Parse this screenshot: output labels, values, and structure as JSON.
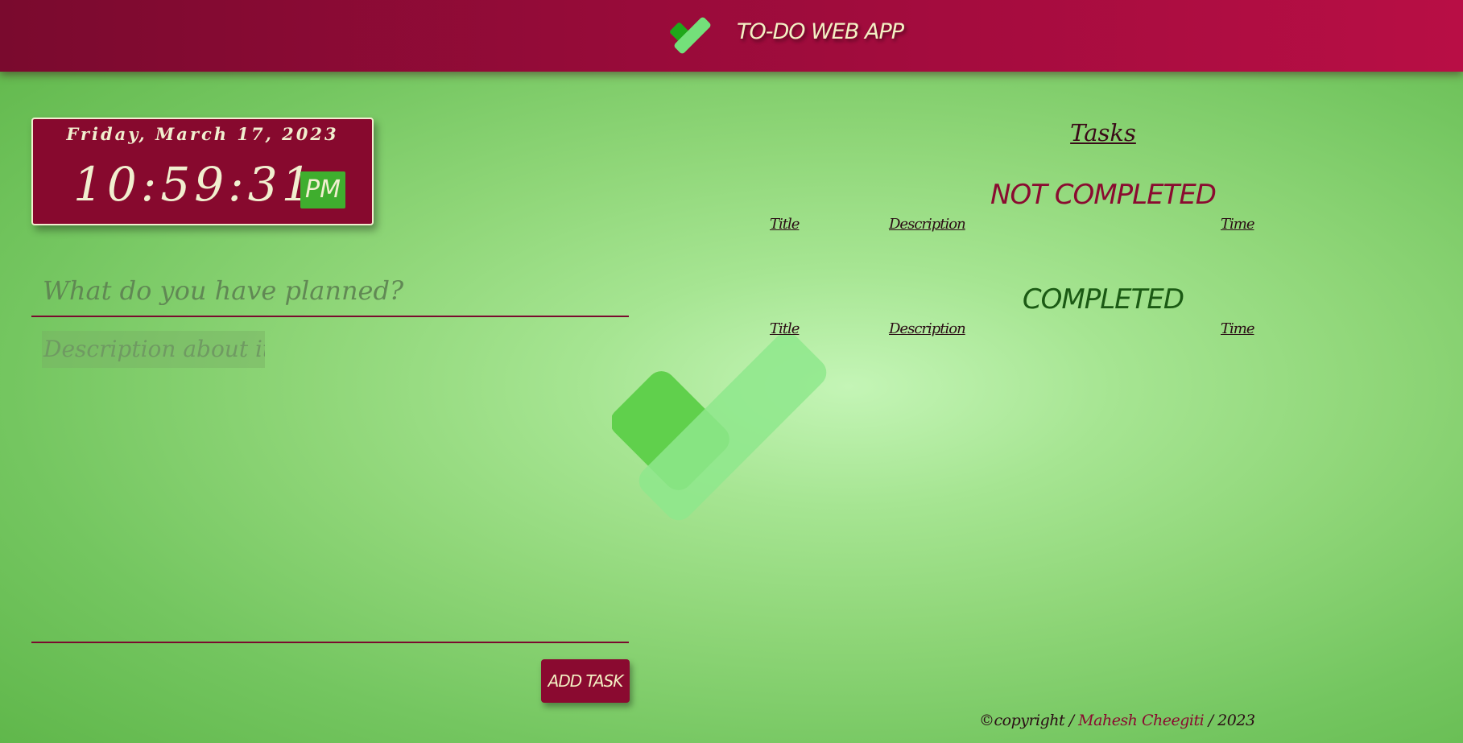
{
  "header": {
    "title": "TO-DO WEB APP",
    "logo_icon": "checkmark-icon",
    "gradient_colors": [
      "#7a0a2e",
      "#b80e45"
    ]
  },
  "clock": {
    "date": "Friday, March 17, 2023",
    "time": "10:59:31",
    "ampm": "PM"
  },
  "form": {
    "title_placeholder": "What do you have planned?",
    "description_placeholder": "Description about it...",
    "title_value": "",
    "description_value": "",
    "add_button_label": "ADD TASK"
  },
  "tasks": {
    "heading": "Tasks",
    "not_completed": {
      "title": "NOT COMPLETED",
      "columns": [
        "Title",
        "Description",
        "Time"
      ],
      "rows": []
    },
    "completed": {
      "title": "COMPLETED",
      "columns": [
        "Title",
        "Description",
        "Time"
      ],
      "rows": []
    }
  },
  "footer": {
    "prefix": "©copyright /",
    "author": "Mahesh Cheegiti",
    "suffix": "/ 2023"
  },
  "colors": {
    "accent": "#8a0a30",
    "ampm_badge": "#3fae2e",
    "cream": "#f1efcf",
    "completed_text": "#1b5a14"
  },
  "background_icon": "checkmark-icon"
}
